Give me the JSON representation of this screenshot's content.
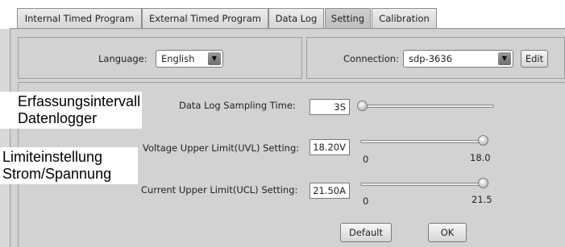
{
  "tabs": [
    {
      "label": "Internal Timed Program",
      "active": false
    },
    {
      "label": "External Timed Program",
      "active": false
    },
    {
      "label": "Data Log",
      "active": false
    },
    {
      "label": "Setting",
      "active": true
    },
    {
      "label": "Calibration",
      "active": false
    }
  ],
  "language": {
    "label": "Language:",
    "value": "English"
  },
  "connection": {
    "label": "Connection:",
    "value": "sdp-3636",
    "edit_label": "Edit"
  },
  "sampling": {
    "label": "Data Log Sampling Time:",
    "value": "3S"
  },
  "voltage": {
    "label": "Voltage Upper Limit(UVL) Setting:",
    "value": "18.20V",
    "min_label": "0",
    "max_label": "18.0",
    "level": 1.0
  },
  "current": {
    "label": "Current Upper Limit(UCL) Setting:",
    "value": "21.50A",
    "min_label": "0",
    "max_label": "21.5",
    "level": 1.0
  },
  "buttons": {
    "default_label": "Default",
    "ok_label": "OK"
  },
  "annotations": {
    "erfassung_line1": "Erfassungsintervall",
    "erfassung_line2": "Datenlogger",
    "limit_line1": "Limiteinstellung",
    "limit_line2": "Strom/Spannung"
  },
  "colors": {
    "panel": "#d2d2d2",
    "active_tab": "#bdbdbd"
  }
}
